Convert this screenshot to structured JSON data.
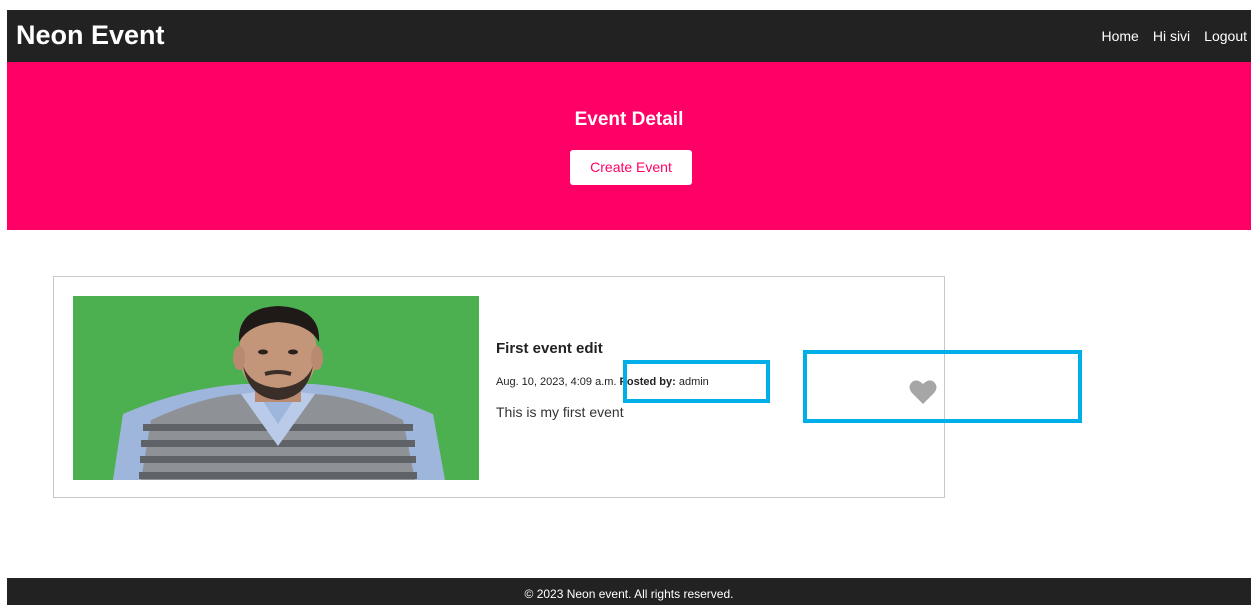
{
  "navbar": {
    "brand": "Neon Event",
    "links": [
      "Home",
      "Hi sivi",
      "Logout"
    ]
  },
  "hero": {
    "title": "Event Detail",
    "button_label": "Create Event"
  },
  "event": {
    "title": "First event edit",
    "date": "Aug. 10, 2023, 4:09 a.m.",
    "posted_by_label": "Posted by:",
    "posted_by": "admin",
    "description": "This is my first event",
    "like_icon": "heart-icon"
  },
  "footer": {
    "text": "© 2023 Neon event. All rights reserved."
  },
  "colors": {
    "navbar": "#222222",
    "hero": "#ff0066",
    "photo_background": "#4caf50",
    "highlight": "#00aee8",
    "heart": "#a6a6a6"
  }
}
